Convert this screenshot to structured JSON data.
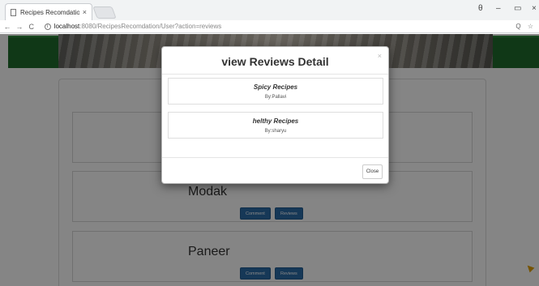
{
  "browser": {
    "tab_title": "Recipes Recomdation",
    "tab_close": "×",
    "url_host": "localhost",
    "url_path": ":8080/RecipesRecomdation/User?action=reviews",
    "nav_back": "←",
    "nav_forward": "→",
    "nav_reload": "C",
    "info_glyph": "i",
    "url_actions": "Q ☆",
    "window_controls": {
      "account": "θ",
      "minimize": "–",
      "maximize": "▭",
      "close": "×"
    }
  },
  "recipes": [
    {
      "name": "",
      "comment_label": "",
      "reviews_label": ""
    },
    {
      "name": "Modak",
      "comment_label": "Comment",
      "reviews_label": "Reviews"
    },
    {
      "name": "Paneer",
      "comment_label": "Comment",
      "reviews_label": "Reviews"
    }
  ],
  "modal": {
    "title": "view Reviews Detail",
    "close_x": "×",
    "reviews": [
      {
        "title": "Spicy Recipes",
        "by": "By:Pallavi"
      },
      {
        "title": "helthy Recipes",
        "by": "By:sharyu"
      }
    ],
    "close_label": "Close"
  },
  "colors": {
    "accent_button": "#2b6ca8",
    "green_banner": "#1f6b2c",
    "overlay": "rgba(0,0,0,0.48)"
  }
}
